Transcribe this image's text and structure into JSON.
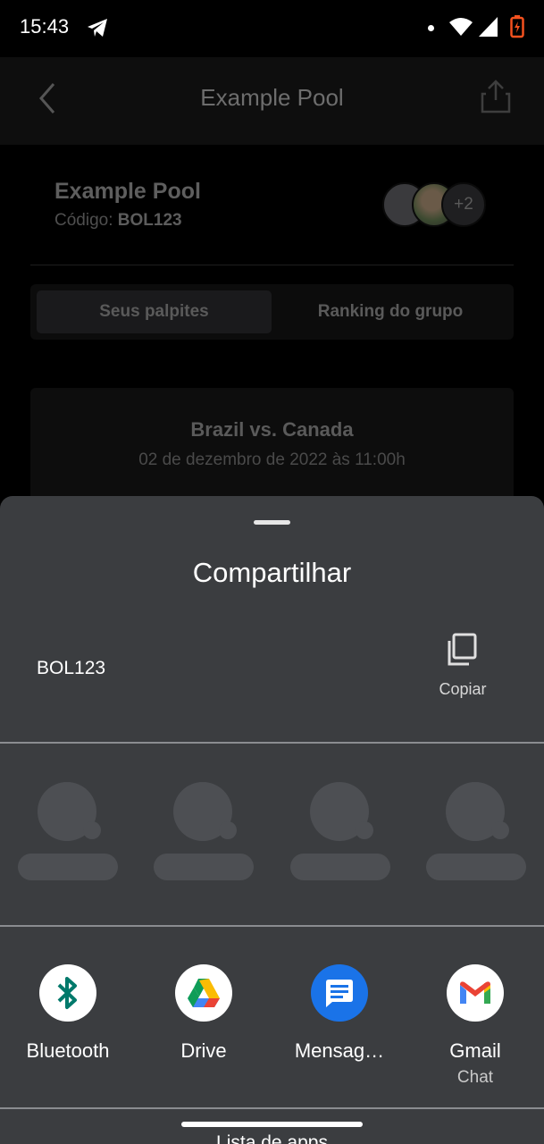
{
  "status_bar": {
    "time": "15:43",
    "icons": [
      "telegram-icon",
      "dot-icon",
      "wifi-icon",
      "signal-icon",
      "battery-icon"
    ]
  },
  "app": {
    "header_title": "Example Pool",
    "pool": {
      "name": "Example Pool",
      "code_label": "Código:",
      "code_value": "BOL123",
      "extra_members": "+2"
    },
    "tabs": [
      "Seus palpites",
      "Ranking do grupo"
    ],
    "match": {
      "title": "Brazil vs. Canada",
      "date": "02 de dezembro de 2022 às 11:00h"
    }
  },
  "share_sheet": {
    "title": "Compartilhar",
    "shared_text": "BOL123",
    "copy_label": "Copiar",
    "apps": [
      {
        "label": "Bluetooth",
        "sublabel": "",
        "icon": "bluetooth-icon"
      },
      {
        "label": "Drive",
        "sublabel": "",
        "icon": "google-drive-icon"
      },
      {
        "label": "Mensag…",
        "sublabel": "",
        "icon": "messages-icon"
      },
      {
        "label": "Gmail",
        "sublabel": "Chat",
        "icon": "gmail-icon"
      }
    ],
    "apps_list_label": "Lista de apps"
  },
  "colors": {
    "sheet_bg": "#3b3d40",
    "messages_blue": "#1a73e8",
    "bluetooth_teal": "#00796b",
    "gmail_red": "#ea4335"
  }
}
